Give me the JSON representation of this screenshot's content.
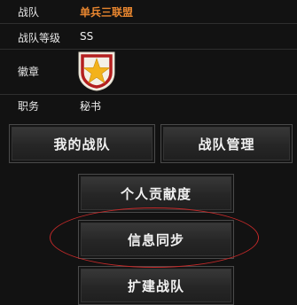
{
  "info": {
    "team_label": "战队",
    "team_value": "单兵三联盟",
    "level_label": "战队等级",
    "level_value": "SS",
    "badge_label": "徽章",
    "role_label": "职务",
    "role_value": "秘书"
  },
  "buttons": {
    "my_team": "我的战队",
    "team_manage": "战队管理",
    "contribution": "个人贡献度",
    "sync": "信息同步",
    "build_team": "扩建战队"
  },
  "colors": {
    "team_name": "#e8862f",
    "highlight_ellipse": "#c62a2a"
  },
  "icons": {
    "badge": "star-shield-icon"
  }
}
